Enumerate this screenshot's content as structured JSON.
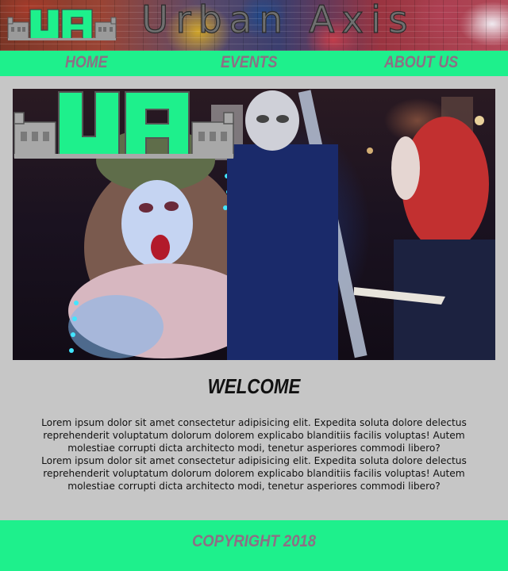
{
  "header": {
    "title": "Urban Axis",
    "logo_text": "UA",
    "logo_icon": "urban-axis-logo-icon"
  },
  "nav": {
    "items": [
      {
        "label": "HOME"
      },
      {
        "label": "EVENTS"
      },
      {
        "label": "ABOUT US"
      }
    ]
  },
  "hero": {
    "image": "street-performers-photo",
    "overlay_logo": "urban-axis-logo-icon"
  },
  "main": {
    "heading": "WELCOME",
    "paragraphs": [
      "Lorem ipsum dolor sit amet consectetur adipisicing elit. Expedita soluta dolore delectus reprehenderit voluptatum dolorum dolorem explicabo blanditiis facilis voluptas! Autem molestiae corrupti dicta architecto modi, tenetur asperiores commodi libero?",
      "Lorem ipsum dolor sit amet consectetur adipisicing elit. Expedita soluta dolore delectus reprehenderit voluptatum dolorum dolorem explicabo blanditiis facilis voluptas! Autem molestiae corrupti dicta architecto modi, tenetur asperiores commodi libero?"
    ]
  },
  "footer": {
    "copyright": "COPYRIGHT 2018"
  },
  "colors": {
    "accent": "#1ef08c",
    "nav_text": "#8d6f85",
    "background": "#c6c6c6",
    "logo_grey": "#8a8a8a"
  }
}
